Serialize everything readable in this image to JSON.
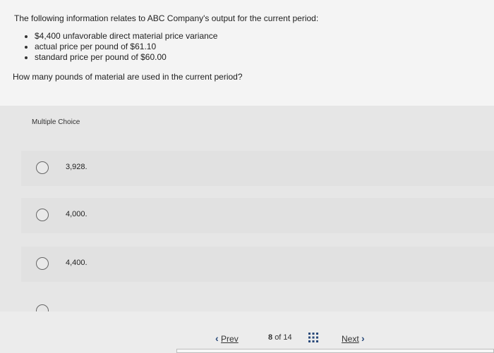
{
  "question": {
    "intro": "The following information relates to ABC Company's output for the current period:",
    "bullets": [
      "$4,400 unfavorable direct material price variance",
      "actual price per pound of $61.10",
      "standard price per pound of $60.00"
    ],
    "ask": "How many pounds of material are used in the current period?"
  },
  "multiple_choice": {
    "label": "Multiple Choice",
    "choices": [
      {
        "text": "3,928."
      },
      {
        "text": "4,000."
      },
      {
        "text": "4,400."
      }
    ]
  },
  "footer": {
    "prev_label": "Prev",
    "next_label": "Next",
    "page_current": "8",
    "page_of": "of 14",
    "prev_chevron": "‹",
    "next_chevron": "›"
  },
  "icons": {
    "grid": "grid-icon",
    "radio": "radio-empty"
  },
  "colors": {
    "chevron": "#2a4a7a",
    "grid": "#2a4a7a"
  }
}
